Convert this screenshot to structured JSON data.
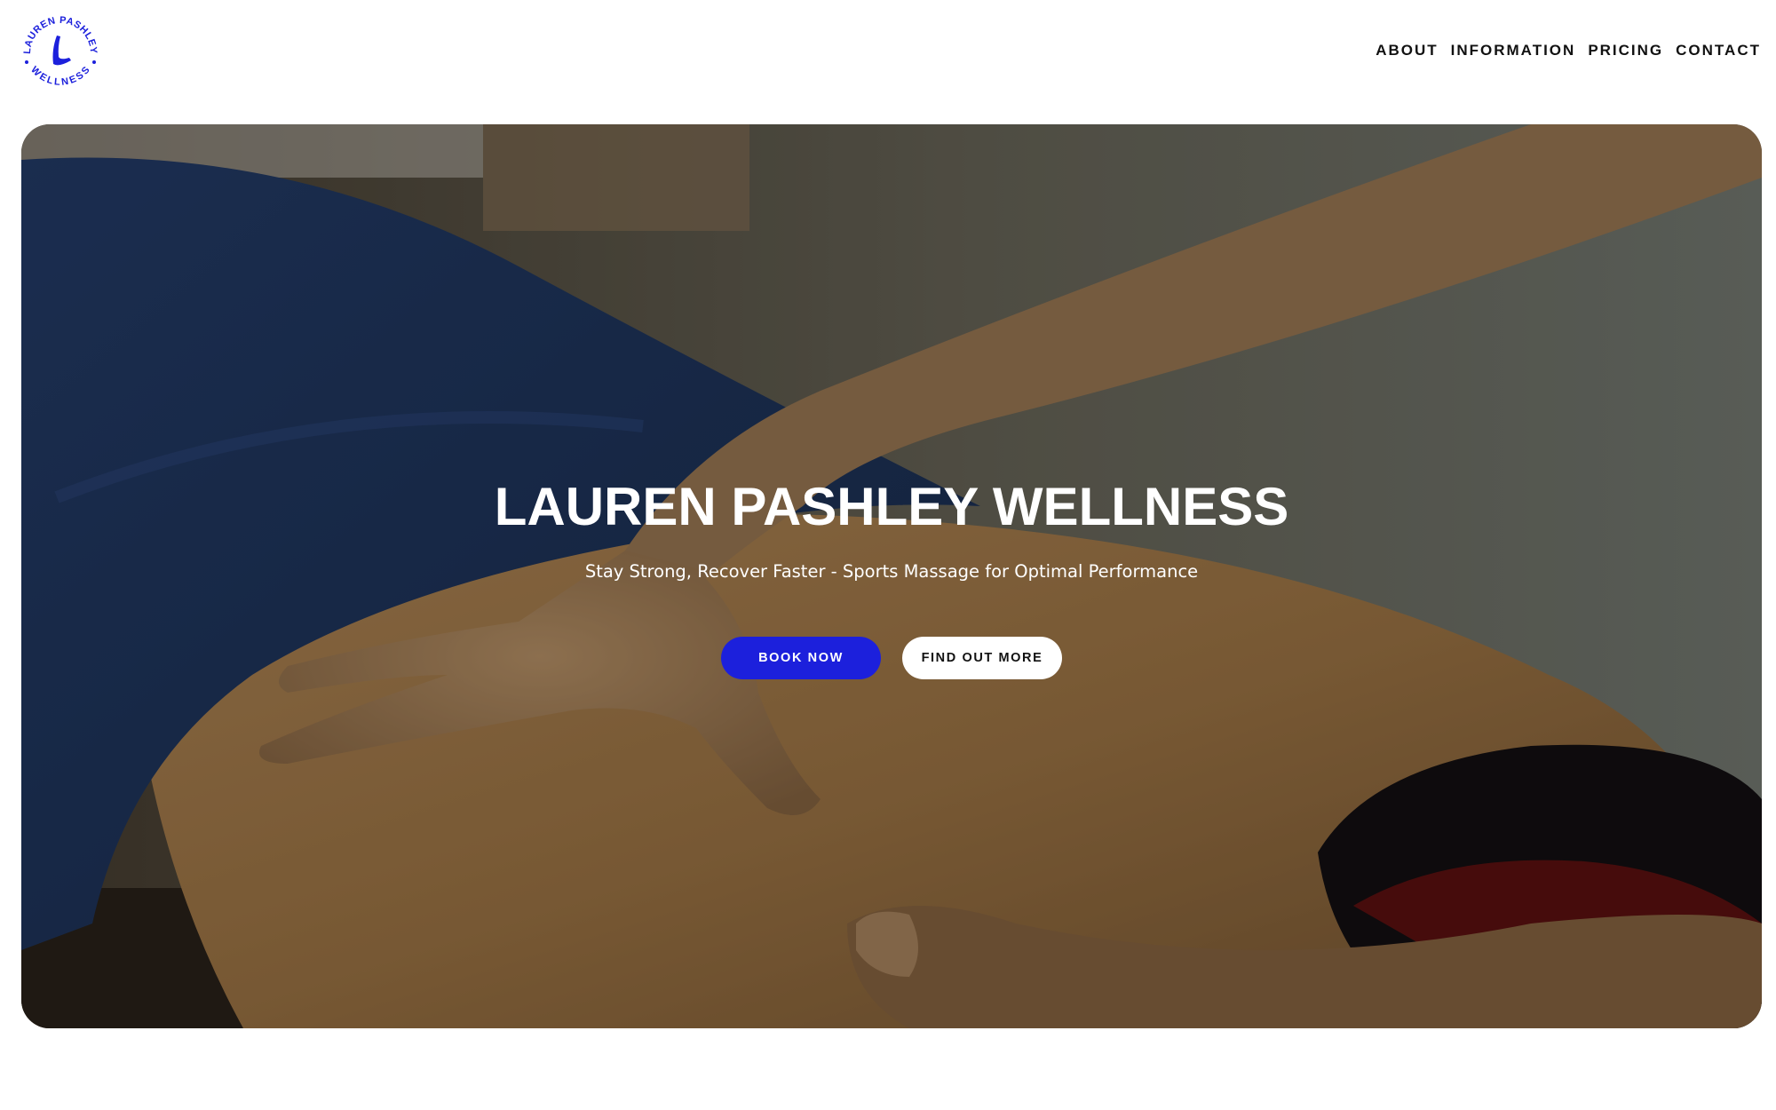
{
  "brand": {
    "logo_text_top": "LAUREN PASHLEY",
    "logo_text_bottom": "WELLNESS",
    "logo_letter": "L",
    "accent_color": "#1c20dc"
  },
  "nav": {
    "items": [
      {
        "label": "ABOUT"
      },
      {
        "label": "INFORMATION"
      },
      {
        "label": "PRICING"
      },
      {
        "label": "CONTACT"
      }
    ]
  },
  "hero": {
    "title": "LAUREN PASHLEY WELLNESS",
    "subtitle": "Stay Strong, Recover Faster - Sports Massage for Optimal Performance",
    "primary_button": "BOOK NOW",
    "secondary_button": "FIND OUT MORE",
    "image_description_icon": "massage-photo"
  }
}
